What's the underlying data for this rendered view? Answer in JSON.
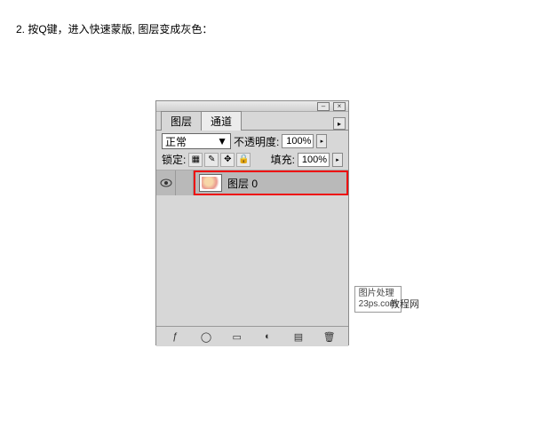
{
  "instruction": "2. 按Q键，进入快速蒙版, 图层变成灰色：",
  "tabs": {
    "layers": "图层",
    "channels": "通道"
  },
  "blend": {
    "mode": "正常",
    "opacity_label": "不透明度:",
    "opacity_value": "100%"
  },
  "lock": {
    "label": "锁定:",
    "fill_label": "填充:",
    "fill_value": "100%"
  },
  "layer": {
    "name": "图层 0"
  },
  "watermark": {
    "line1": "图片处理",
    "line2": "23ps.com",
    "overlap": "教程网"
  },
  "icons": {
    "minimize": "–",
    "close": "×",
    "menu": "▸",
    "dropdown": "▼",
    "arrow": "▸",
    "lock_transparent": "▦",
    "lock_brush": "✎",
    "lock_move": "✥",
    "lock_all": "🔒",
    "fx": "ƒ",
    "mask": "◯",
    "folder": "▭",
    "adjust": "◐",
    "new": "▤",
    "trash": "🗑"
  }
}
